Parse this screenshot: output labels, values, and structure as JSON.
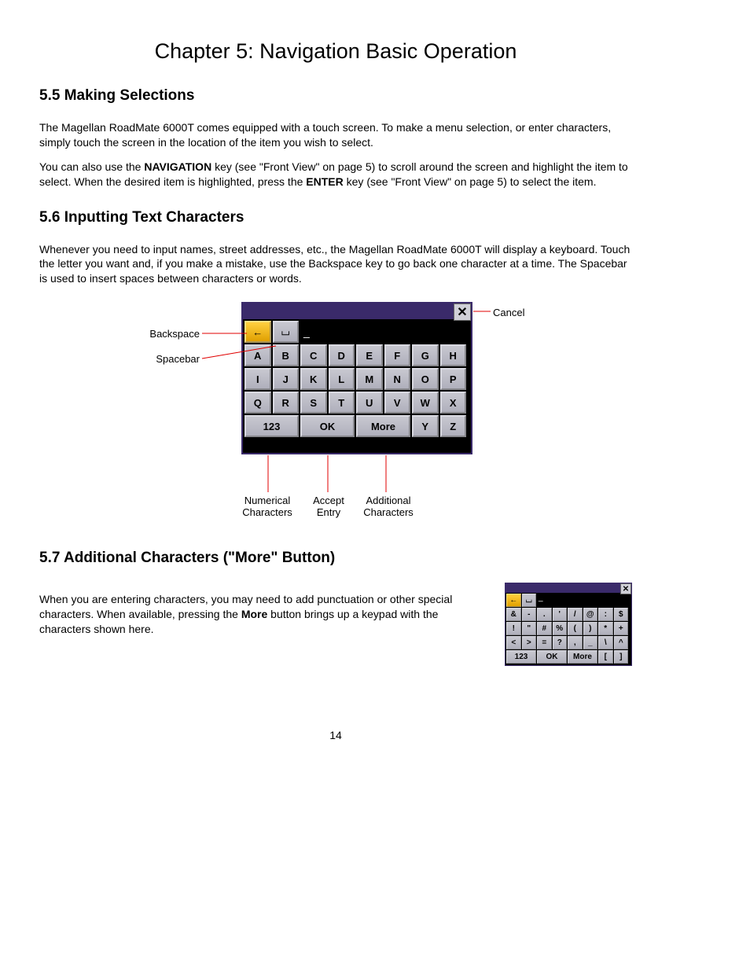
{
  "chapter_title": "Chapter 5: Navigation Basic Operation",
  "sec55": {
    "heading": "5.5 Making Selections",
    "p1": "The Magellan RoadMate 6000T comes equipped with a touch screen. To make a menu selection, or enter characters, simply touch the screen in the location of the item you wish to select.",
    "p2a": "You can also use the ",
    "p2b_bold": "NAVIGATION",
    "p2c": " key (see \"Front View\" on page 5) to scroll around the screen and highlight the item to select. When the desired item is highlighted, press the ",
    "p2d_bold": "ENTER",
    "p2e": " key (see \"Front View\" on page 5) to select the item."
  },
  "sec56": {
    "heading": "5.6 Inputting Text Characters",
    "p1": "Whenever you need to input names, street addresses, etc., the Magellan RoadMate 6000T will display a keyboard. Touch the letter you want and, if you make a mistake, use the Backspace key to go back one character at a time. The Spacebar is used to insert spaces between characters or words.",
    "labels": {
      "backspace": "Backspace",
      "spacebar": "Spacebar",
      "cancel": "Cancel",
      "num_chars_1": "Numerical",
      "num_chars_2": "Characters",
      "accept_1": "Accept",
      "accept_2": "Entry",
      "addl_1": "Additional",
      "addl_2": "Characters"
    },
    "keyboard": {
      "cursor": "_",
      "row1": [
        "A",
        "B",
        "C",
        "D",
        "E",
        "F",
        "G",
        "H"
      ],
      "row2": [
        "I",
        "J",
        "K",
        "L",
        "M",
        "N",
        "O",
        "P"
      ],
      "row3": [
        "Q",
        "R",
        "S",
        "T",
        "U",
        "V",
        "W",
        "X"
      ],
      "row4_123": "123",
      "row4_ok": "OK",
      "row4_more": "More",
      "row4_y": "Y",
      "row4_z": "Z",
      "backspace_arrow": "←",
      "spacebar_sym": "⌴"
    }
  },
  "sec57": {
    "heading": "5.7 Additional Characters (\"More\" Button)",
    "p1a": "When you are entering characters, you may need to add punctuation or other special characters. When available, pressing the ",
    "p1b_bold": "More",
    "p1c": " button brings up a keypad with the characters shown here.",
    "keyboard": {
      "cursor": "_",
      "backspace_arrow": "←",
      "spacebar_sym": "⌴",
      "row1": [
        "&",
        "-",
        ".",
        "'",
        "/",
        "@",
        ":",
        "$"
      ],
      "row2": [
        "!",
        "\"",
        "#",
        "%",
        "(",
        ")",
        "*",
        "+"
      ],
      "row3": [
        "<",
        ">",
        "=",
        "?",
        ",",
        "_",
        "\\",
        "^"
      ],
      "row4_123": "123",
      "row4_ok": "OK",
      "row4_more": "More",
      "row4_lb": "[",
      "row4_rb": "]"
    }
  },
  "page_number": "14"
}
